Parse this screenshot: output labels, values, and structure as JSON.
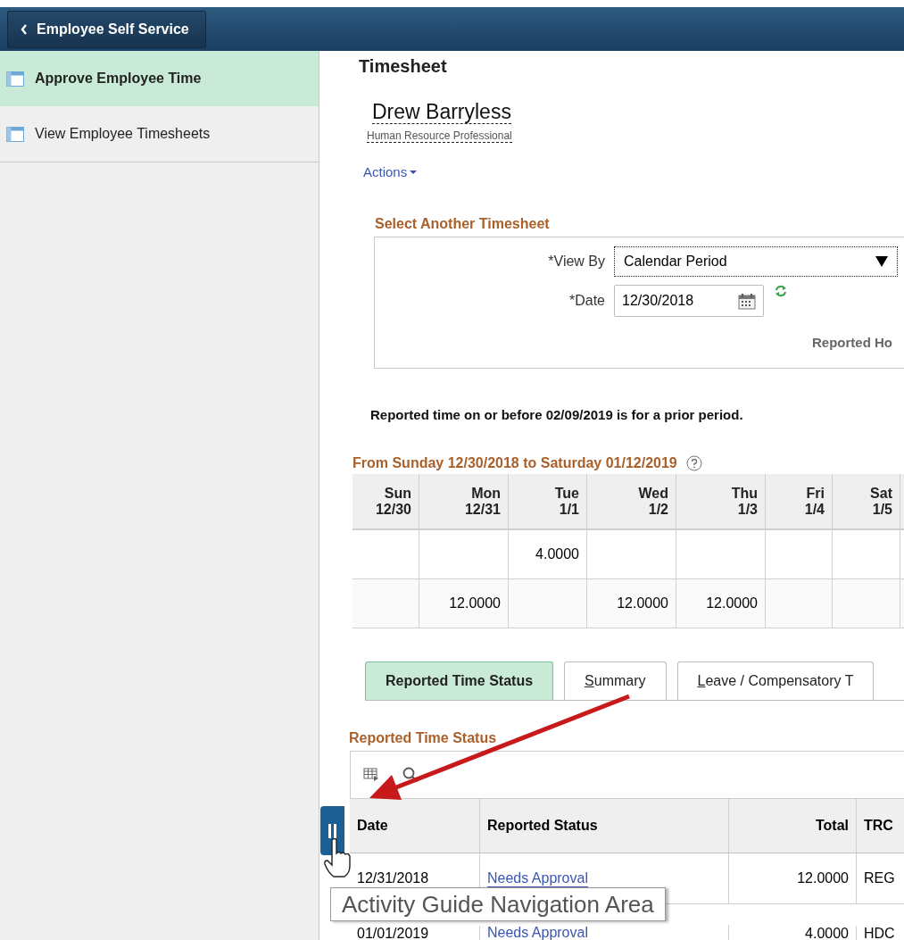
{
  "header": {
    "back_label": "Employee Self Service"
  },
  "sidebar": {
    "items": [
      {
        "label": "Approve Employee Time",
        "selected": true
      },
      {
        "label": "View Employee Timesheets",
        "selected": false
      }
    ]
  },
  "page_title": "Timesheet",
  "employee": {
    "name": "Drew Barryless",
    "job_title": "Human Resource Professional"
  },
  "actions_label": "Actions",
  "select_section": {
    "title": "Select Another Timesheet",
    "view_by": {
      "label": "*View By",
      "value": "Calendar Period"
    },
    "date": {
      "label": "*Date",
      "value": "12/30/2018"
    },
    "reported_hours_label": "Reported Ho"
  },
  "notice": "Reported time on or before 02/09/2019 is for a prior period.",
  "period": {
    "title": "From Sunday 12/30/2018 to Saturday 01/12/2019",
    "columns": [
      {
        "day": "Sun",
        "date": "12/30"
      },
      {
        "day": "Mon",
        "date": "12/31"
      },
      {
        "day": "Tue",
        "date": "1/1"
      },
      {
        "day": "Wed",
        "date": "1/2"
      },
      {
        "day": "Thu",
        "date": "1/3"
      },
      {
        "day": "Fri",
        "date": "1/4"
      },
      {
        "day": "Sat",
        "date": "1/5"
      }
    ],
    "rows": [
      [
        null,
        null,
        "4.0000",
        null,
        null,
        null,
        null
      ],
      [
        null,
        "12.0000",
        null,
        "12.0000",
        "12.0000",
        null,
        null
      ]
    ]
  },
  "tabs": [
    {
      "label": "Reported Time Status",
      "selected": true,
      "access_key_underlined": false
    },
    {
      "label": "Summary",
      "selected": false,
      "access_key_underlined": true
    },
    {
      "label": "Leave / Compensatory T",
      "selected": false,
      "access_key_underlined": true
    }
  ],
  "status_grid": {
    "title": "Reported Time Status",
    "columns": [
      "Date",
      "Reported Status",
      "Total",
      "TRC"
    ],
    "rows": [
      {
        "date": "12/31/2018",
        "status": "Needs Approval",
        "total": "12.0000",
        "trc": "REG"
      },
      {
        "date": "01/01/2019",
        "status": "Needs Approval",
        "total": "4.0000",
        "trc": "HDC"
      }
    ]
  },
  "tooltip": "Activity Guide Navigation Area"
}
